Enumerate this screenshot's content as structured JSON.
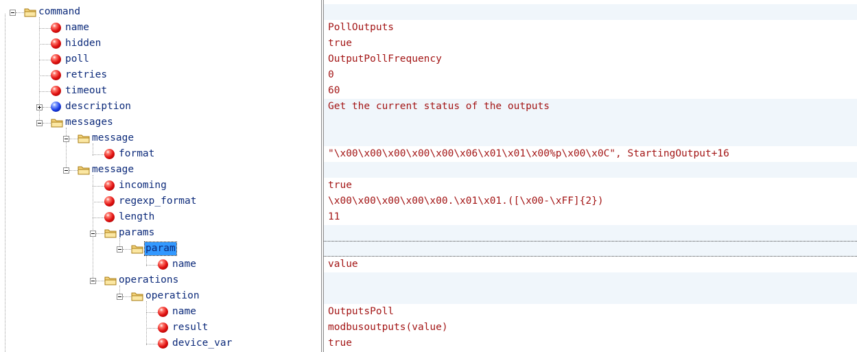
{
  "tree": {
    "nodes": [
      {
        "label": "command",
        "icon": "folder-icon",
        "level": 0,
        "expander": "minus"
      },
      {
        "label": "name",
        "icon": "red-attribute-icon",
        "level": 1
      },
      {
        "label": "hidden",
        "icon": "red-attribute-icon",
        "level": 1
      },
      {
        "label": "poll",
        "icon": "red-attribute-icon",
        "level": 1
      },
      {
        "label": "retries",
        "icon": "red-attribute-icon",
        "level": 1
      },
      {
        "label": "timeout",
        "icon": "red-attribute-icon",
        "level": 1
      },
      {
        "label": "description",
        "icon": "blue-element-icon",
        "level": 1,
        "expander": "plus"
      },
      {
        "label": "messages",
        "icon": "folder-icon",
        "level": 1,
        "expander": "minus"
      },
      {
        "label": "message",
        "icon": "folder-icon",
        "level": 2,
        "expander": "minus"
      },
      {
        "label": "format",
        "icon": "red-attribute-icon",
        "level": 3
      },
      {
        "label": "message",
        "icon": "folder-icon",
        "level": 2,
        "expander": "minus"
      },
      {
        "label": "incoming",
        "icon": "red-attribute-icon",
        "level": 3
      },
      {
        "label": "regexp_format",
        "icon": "red-attribute-icon",
        "level": 3
      },
      {
        "label": "length",
        "icon": "red-attribute-icon",
        "level": 3
      },
      {
        "label": "params",
        "icon": "folder-icon",
        "level": 3,
        "expander": "minus"
      },
      {
        "label": "param",
        "icon": "folder-icon",
        "level": 4,
        "expander": "minus",
        "selected": true
      },
      {
        "label": "name",
        "icon": "red-attribute-icon",
        "level": 5
      },
      {
        "label": "operations",
        "icon": "folder-icon",
        "level": 3,
        "expander": "minus"
      },
      {
        "label": "operation",
        "icon": "folder-icon",
        "level": 4,
        "expander": "minus"
      },
      {
        "label": "name",
        "icon": "red-attribute-icon",
        "level": 5
      },
      {
        "label": "result",
        "icon": "red-attribute-icon",
        "level": 5
      },
      {
        "label": "device_var",
        "icon": "red-attribute-icon",
        "level": 5
      }
    ]
  },
  "values": [
    "",
    "PollOutputs",
    "true",
    "OutputPollFrequency",
    "0",
    "60",
    "Get the current status of the outputs",
    "",
    "",
    "\"\\x00\\x00\\x00\\x00\\x00\\x06\\x01\\x01\\x00%p\\x00\\x0C\", StartingOutput+16",
    "",
    "true",
    "\\x00\\x00\\x00\\x00\\x00.\\x01\\x01.([\\x00-\\xFF]{2})",
    "11",
    "",
    "",
    "value",
    "",
    "",
    "OutputsPoll",
    "modbusoutputs(value)",
    "true"
  ],
  "colors": {
    "label_text": "#0c2a7a",
    "value_text": "#a31515",
    "selection": "#3399ff",
    "band": "#f0f6fb"
  }
}
